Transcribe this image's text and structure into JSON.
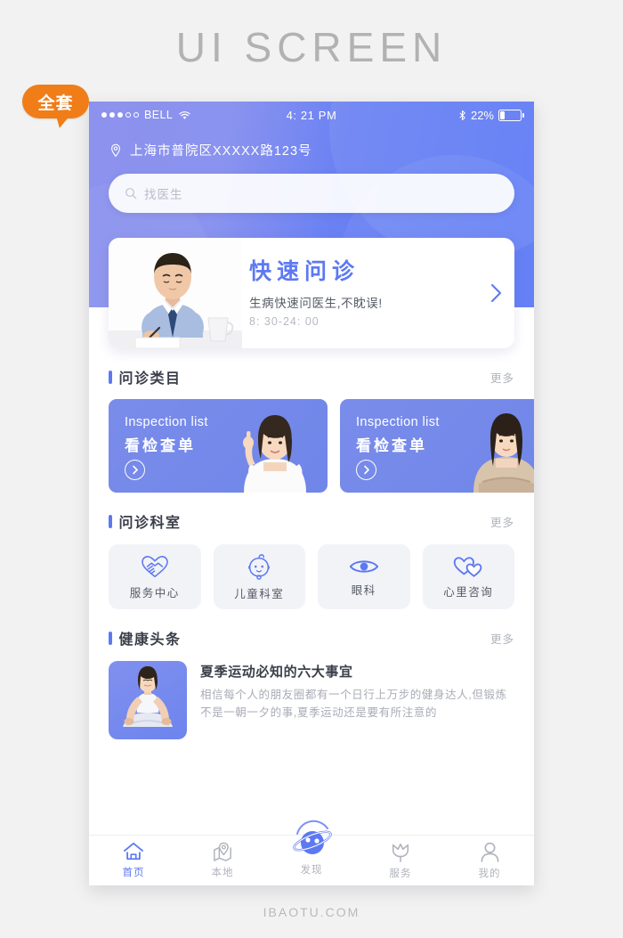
{
  "page": {
    "title": "UI SCREEN",
    "footer_watermark": "IBAOTU.COM",
    "badge_label": "全套",
    "accent_color": "#5d79f2",
    "badge_color": "#f07d18"
  },
  "statusbar": {
    "carrier": "BELL",
    "time": "4: 21 PM",
    "battery_percent": "22%",
    "signal_icon": "signal-dots-icon",
    "wifi_icon": "wifi-icon",
    "bluetooth_icon": "bluetooth-icon",
    "battery_icon": "battery-icon"
  },
  "header": {
    "location_icon": "map-pin-icon",
    "location": "上海市普院区XXXXX路123号",
    "search": {
      "icon": "search-icon",
      "placeholder": "找医生",
      "value": ""
    }
  },
  "banner": {
    "photo_alt": "doctor-photo",
    "title": "快速问诊",
    "subtitle": "生病快速问医生,不眈误!",
    "time": "8: 30-24: 00",
    "arrow_icon": "chevron-right-icon"
  },
  "sections": [
    {
      "title": "问诊类目",
      "more_label": "更多"
    },
    {
      "title": "问诊科室",
      "more_label": "更多"
    },
    {
      "title": "健康头条",
      "more_label": "更多"
    }
  ],
  "category_cards": [
    {
      "en": "Inspection list",
      "cn": "看检查单",
      "arrow_icon": "chevron-right-circle-icon",
      "photo_alt": "woman-pointing-photo"
    },
    {
      "en": "Inspection list",
      "cn": "看检查单",
      "arrow_icon": "chevron-right-circle-icon",
      "photo_alt": "woman-arms-crossed-photo"
    }
  ],
  "departments": [
    {
      "label": "服务中心",
      "icon": "handshake-heart-icon"
    },
    {
      "label": "儿童科室",
      "icon": "baby-face-icon"
    },
    {
      "label": "眼科",
      "icon": "eye-icon"
    },
    {
      "label": "心里咨询",
      "icon": "double-heart-icon"
    }
  ],
  "news": {
    "thumb_alt": "yoga-woman-photo",
    "title": "夏季运动必知的六大事宜",
    "desc": "相信每个人的朋友圈都有一个日行上万步的健身达人,但锻炼不是一朝一夕的事,夏季运动还是要有所注意的"
  },
  "tabbar": [
    {
      "label": "首页",
      "icon": "home-icon",
      "active": true
    },
    {
      "label": "本地",
      "icon": "location-map-icon",
      "active": false
    },
    {
      "label": "发现",
      "icon": "planet-icon",
      "active": false
    },
    {
      "label": "服务",
      "icon": "tulip-icon",
      "active": false
    },
    {
      "label": "我的",
      "icon": "user-icon",
      "active": false
    }
  ]
}
